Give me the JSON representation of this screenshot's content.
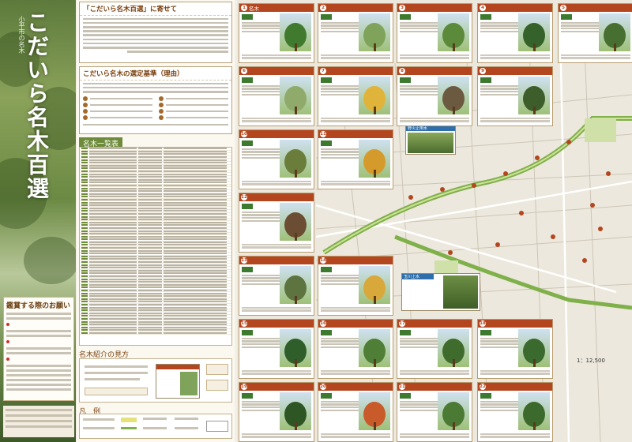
{
  "banner": {
    "title": "こだいら名木百選",
    "subtitle": "小平市の名木"
  },
  "intro": {
    "heading": "「こだいら名木百選」に寄せて",
    "criteria_heading": "こだいら名木の選定基準（理由）"
  },
  "list": {
    "heading": "名木一覧表"
  },
  "how": {
    "heading": "名木紹介の見方"
  },
  "legend": {
    "heading": "凡　例"
  },
  "notice": {
    "heading": "鑑賞する際のお願い"
  },
  "map": {
    "scale": "1：12,500",
    "green_road_label": "玉川上水",
    "station_label": "野火止用水"
  },
  "cards": [
    {
      "num": "1",
      "title": "名木",
      "tree": "#3f7a2e"
    },
    {
      "num": "2",
      "title": "",
      "tree": "#7fa35a"
    },
    {
      "num": "3",
      "title": "",
      "tree": "#5a8a3a"
    },
    {
      "num": "4",
      "title": "",
      "tree": "#35612a"
    },
    {
      "num": "5",
      "title": "",
      "tree": "#476f32"
    },
    {
      "num": "6",
      "title": "",
      "tree": "#8faa6a"
    },
    {
      "num": "7",
      "title": "",
      "tree": "#e0b43a"
    },
    {
      "num": "8",
      "title": "",
      "tree": "#6b5a3f"
    },
    {
      "num": "9",
      "title": "",
      "tree": "#3d5e2b"
    },
    {
      "num": "10",
      "title": "",
      "tree": "#6b7d3a"
    },
    {
      "num": "11",
      "title": "",
      "tree": "#d49b2c"
    },
    {
      "num": "12",
      "title": "",
      "tree": "#6b4d33"
    },
    {
      "num": "13",
      "title": "",
      "tree": "#5d7440"
    },
    {
      "num": "14",
      "title": "",
      "tree": "#d9a83b"
    },
    {
      "num": "15",
      "title": "",
      "tree": "#2f5e2a"
    },
    {
      "num": "16",
      "title": "",
      "tree": "#4f7f36"
    },
    {
      "num": "17",
      "title": "",
      "tree": "#3f6c2c"
    },
    {
      "num": "18",
      "title": "",
      "tree": "#3a6a2e"
    },
    {
      "num": "19",
      "title": "",
      "tree": "#2e5624"
    },
    {
      "num": "20",
      "title": "",
      "tree": "#c95a2a"
    },
    {
      "num": "21",
      "title": "",
      "tree": "#4b7a34"
    },
    {
      "num": "22",
      "title": "",
      "tree": "#3b6a2c"
    }
  ],
  "colors": {
    "card_header": "#b4461f",
    "green_road": "#7fb04a",
    "accent": "#7a3f0c"
  }
}
